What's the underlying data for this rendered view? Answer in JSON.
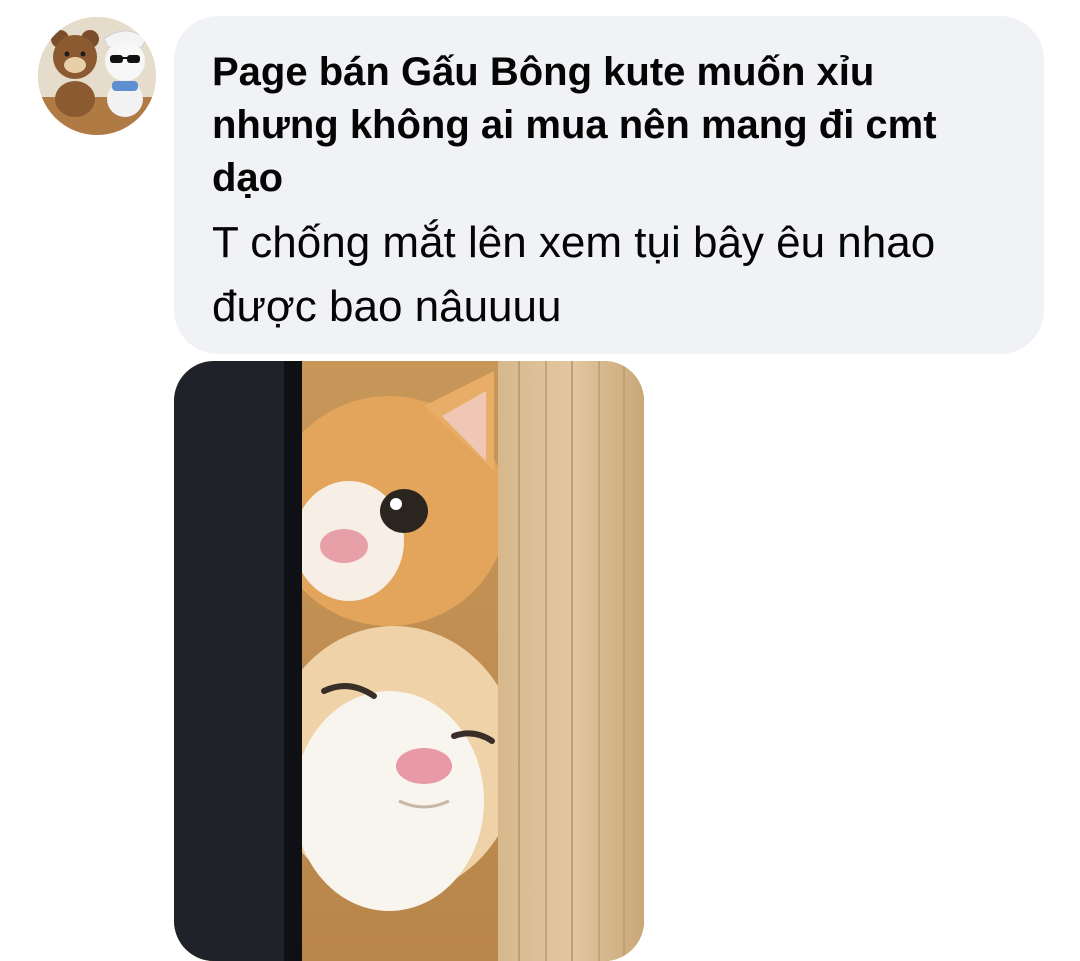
{
  "comment": {
    "author": "Page bán Gấu Bông kute muốn xỉu nhưng không ai mua nên mang đi cmt dạo",
    "text": "T chống mắt lên xem tụi bây êu nhao được bao nâuuuu",
    "avatar_icon": "teddy-bear-plush-avatar",
    "attachment_icon": "two-cats-peeking-photo"
  },
  "colors": {
    "bubble_bg": "#f0f2f5",
    "text": "#050505"
  }
}
